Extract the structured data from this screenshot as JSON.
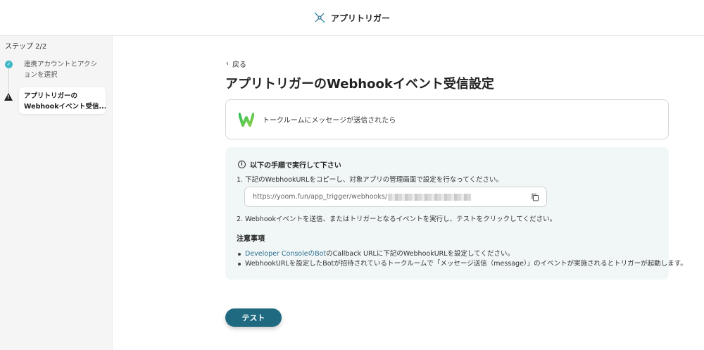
{
  "header": {
    "app_title": "アプリトリガー",
    "icon": "trigger-icon"
  },
  "sidebar": {
    "step_count": "ステップ 2/2",
    "steps": [
      {
        "label": "連携アカウントとアクションを選択",
        "status": "complete"
      },
      {
        "label": "アプリトリガーのWebhookイベント受信...",
        "label_line1": "アプリトリガーの",
        "label_line2": "Webhookイベント受信...",
        "status": "current-warning"
      }
    ]
  },
  "main": {
    "back_label": "戻る",
    "title": "アプリトリガーのWebhookイベント受信設定",
    "trigger_card": {
      "label": "トークルームにメッセージが送信されたら",
      "app_icon": "works-logo-icon"
    },
    "instructions": {
      "heading": "以下の手順で実行して下さい",
      "step1": "1. 下記のWebhookURLをコピーし、対象アプリの管理画面で設定を行なってください。",
      "url": "https://yoom.fun/app_trigger/webhooks/",
      "step2": "2. Webhookイベントを送信、またはトリガーとなるイベントを実行し、テストをクリックしてください。",
      "notes_title": "注意事項",
      "notes": {
        "note1_link": "Developer ConsoleのBot",
        "note1_text": "のCallback URLに下記のWebhookURLを設定してください。",
        "note2_text": "WebhookURLを設定したBotが招待されているトークルームで「メッセージ送信（message）」のイベントが実施されるとトリガーが起動します。"
      }
    },
    "test_button": "テスト"
  },
  "colors": {
    "accent": "#1f6a80",
    "check": "#3fb8c8",
    "info_bg": "#f1f6f6",
    "link": "#2c6e8e"
  }
}
